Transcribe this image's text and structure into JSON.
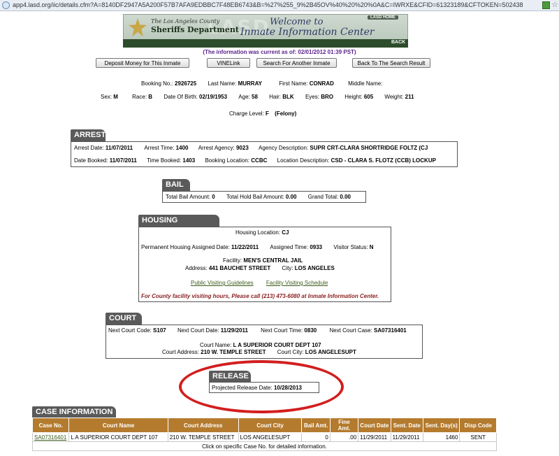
{
  "browser": {
    "url": "app4.lasd.org/iic/details.cfm?A=8140DF2947A5A200F57B7AFA9EDBBC7F48EB6743&B=%27%255_9%2B45OV%40%20%20%0A&C=IWRXE&CFID=61323189&CFTOKEN=502438"
  },
  "banner": {
    "county": "The Los Angeles County",
    "department": "Sheriffs Department",
    "watermark": "LASD",
    "welcome": "Welcome to",
    "center": "Inmate Information Center",
    "home_label": "LASD HOME",
    "back_label": "BACK"
  },
  "as_of": "(The information was current as of: 02/01/2012 01:39 PST)",
  "buttons": {
    "deposit": "Deposit Money for This Inmate",
    "vinelink": "VINELink",
    "search_another": "Search For Another Inmate",
    "back_to_results": "Back To The Search Result"
  },
  "inmate": {
    "booking_label": "Booking No.:",
    "booking": "2926725",
    "last_label": "Last Name:",
    "last": "MURRAY",
    "first_label": "First Name:",
    "first": "CONRAD",
    "middle_label": "Middle Name:",
    "middle": "",
    "sex_label": "Sex:",
    "sex": "M",
    "race_label": "Race:",
    "race": "B",
    "dob_label": "Date Of Birth:",
    "dob": "02/19/1953",
    "age_label": "Age:",
    "age": "58",
    "hair_label": "Hair:",
    "hair": "BLK",
    "eyes_label": "Eyes:",
    "eyes": "BRO",
    "height_label": "Height:",
    "height": "605",
    "weight_label": "Weight:",
    "weight": "211",
    "charge_label": "Charge Level:",
    "charge": "F",
    "charge_desc": "(Felony)"
  },
  "arrest": {
    "title": "ARREST",
    "date_label": "Arrest Date:",
    "date": "11/07/2011",
    "time_label": "Arrest Time:",
    "time": "1400",
    "agency_label": "Arrest Agency:",
    "agency": "9023",
    "agency_desc_label": "Agency Description:",
    "agency_desc": "SUPR CRT-CLARA SHORTRIDGE FOLTZ (CJ",
    "booked_label": "Date Booked:",
    "booked": "11/07/2011",
    "time_booked_label": "Time Booked:",
    "time_booked": "1403",
    "booking_loc_label": "Booking Location:",
    "booking_loc": "CCBC",
    "loc_desc_label": "Location Description:",
    "loc_desc": "CSD - CLARA S. FLOTZ (CCB) LOCKUP"
  },
  "bail": {
    "title": "BAIL",
    "total_label": "Total Bail Amount:",
    "total": "0",
    "hold_label": "Total Hold Bail Amount:",
    "hold": "0.00",
    "grand_label": "Grand Total:",
    "grand": "0.00"
  },
  "housing": {
    "title": "HOUSING LOCATION",
    "loc_label": "Housing Location:",
    "loc": "CJ",
    "perm_label": "Permanent Housing Assigned Date:",
    "perm": "11/22/2011",
    "assigned_time_label": "Assigned Time:",
    "assigned_time": "0933",
    "visitor_label": "Visitor Status:",
    "visitor": "N",
    "facility_label": "Facility:",
    "facility": "MEN'S CENTRAL JAIL",
    "address_label": "Address:",
    "address": "441 BAUCHET STREET",
    "city_label": "City:",
    "city": "LOS ANGELES",
    "link_guidelines": "Public Visiting Guidelines",
    "link_schedule": "Facility Visiting Schedule",
    "notice": "For County facility visiting hours, Please call (213) 473-6080 at Inmate Information Center."
  },
  "court": {
    "title": "COURT",
    "code_label": "Next Court Code:",
    "code": "S107",
    "date_label": "Next Court Date:",
    "date": "11/29/2011",
    "time_label": "Next Court Time:",
    "time": "0830",
    "case_label": "Next Court Case:",
    "case": "SA07316401",
    "name_label": "Court Name:",
    "name": "L A SUPERIOR COURT DEPT 107",
    "addr_label": "Court Address:",
    "addr": "210 W. TEMPLE STREET",
    "city_label": "Court City:",
    "city": "LOS ANGELESUPT"
  },
  "release": {
    "title": "RELEASE",
    "label": "Projected Release Date:",
    "date": "10/28/2013"
  },
  "cases": {
    "title": "CASE INFORMATION",
    "headers": [
      "Case No.",
      "Court Name",
      "Court Address",
      "Court City",
      "Bail Amt.",
      "Fine Amt.",
      "Court Date",
      "Sent. Date",
      "Sent. Day(s)",
      "Disp Code"
    ],
    "rows": [
      [
        "SA07316401",
        "L A SUPERIOR COURT DEPT 107",
        "210 W. TEMPLE STREET",
        "LOS ANGELESUPT",
        "0",
        ".00",
        "11/29/2011",
        "11/29/2011",
        "1460",
        "SENT"
      ]
    ],
    "footer": "Click on specific Case No. for detailed information."
  },
  "colors": {
    "header_brown": "#b47b2e",
    "section_gray": "#5a5a5a",
    "circle_red": "#d21e1e"
  }
}
